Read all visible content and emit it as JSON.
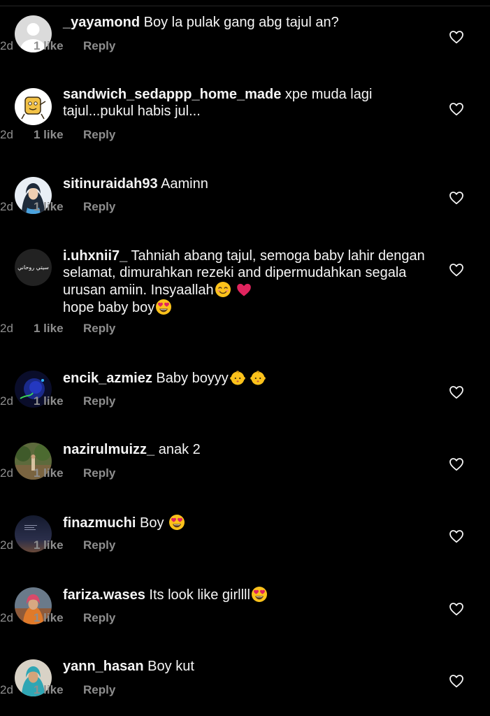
{
  "comments": [
    {
      "username": "_yayamond",
      "text": "Boy la pulak gang abg tajul an?",
      "age": "2d",
      "likes": "1 like",
      "reply": "Reply"
    },
    {
      "username": "sandwich_sedappp_home_made",
      "text": "xpe muda lagi tajul...pukul habis jul...",
      "age": "2d",
      "likes": "1 like",
      "reply": "Reply"
    },
    {
      "username": "sitinuraidah93",
      "text": "Aaminn",
      "age": "2d",
      "likes": "1 like",
      "reply": "Reply"
    },
    {
      "username": "i.uhxnii7_",
      "text_part1": "Tahniah abang tajul, semoga baby lahir dengan selamat, dimurahkan rezeki and dipermudahkan segala urusan amiin. Insyaallah",
      "text_part2": "hope baby boy",
      "avatar_text": "سيتي روحاني",
      "age": "2d",
      "likes": "1 like",
      "reply": "Reply"
    },
    {
      "username": "encik_azmiez",
      "text": "Baby boyyy",
      "age": "2d",
      "likes": "1 like",
      "reply": "Reply"
    },
    {
      "username": "nazirulmuizz_",
      "text": "anak 2",
      "age": "2d",
      "likes": "1 like",
      "reply": "Reply"
    },
    {
      "username": "finazmuchi",
      "text": "Boy",
      "age": "2d",
      "likes": "1 like",
      "reply": "Reply"
    },
    {
      "username": "fariza.wases",
      "text": "Its look like girllll",
      "age": "2d",
      "likes": "1 like",
      "reply": "Reply"
    },
    {
      "username": "yann_hasan",
      "text": "Boy kut",
      "age": "2d",
      "likes": "1 like",
      "reply": "Reply"
    }
  ],
  "icons": {
    "like": "heart-outline-icon",
    "emoji_smile": "smiling-face-emoji",
    "emoji_heart": "red-heart-emoji",
    "emoji_heart_eyes": "heart-eyes-emoji",
    "emoji_baby": "baby-emoji"
  },
  "colors": {
    "background": "#000000",
    "primary_text": "#f5f5f5",
    "secondary_text": "#8e8e8e"
  }
}
